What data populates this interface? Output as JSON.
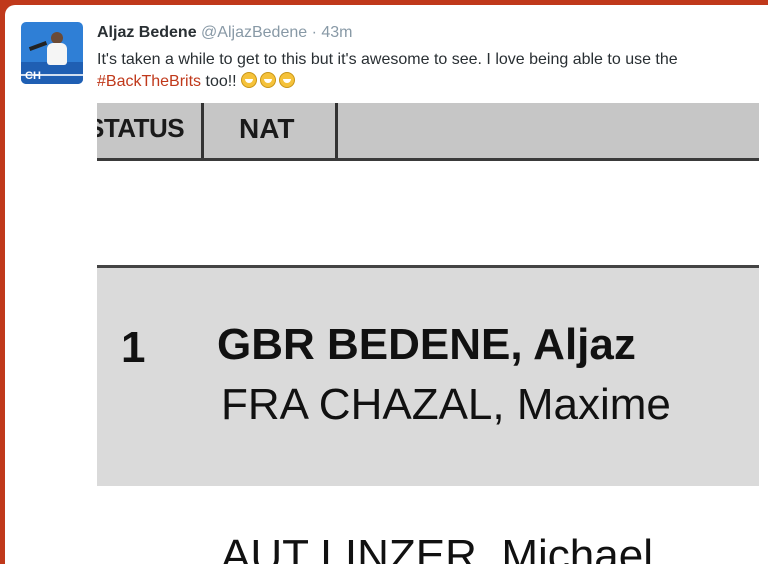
{
  "tweet": {
    "author_name": "Aljaz Bedene",
    "author_handle": "@AljazBedene",
    "separator": "·",
    "time": "43m",
    "text_part1": "It's taken a while to get to this but it's awesome to see. I love being able to use the ",
    "hashtag": "#BackTheBrits",
    "text_part2": " too!! ",
    "emoji_name": "grinning-face-icon",
    "avatar_badge": "CH"
  },
  "photo": {
    "header_status": "STATUS",
    "header_nat": "NAT",
    "seed": "1",
    "player1": "GBR BEDENE, Aljaz",
    "player2": "FRA  CHAZAL, Maxime",
    "player3": "AUT  LINZER, Michael"
  },
  "colors": {
    "frame": "#c0391b",
    "hashtag": "#c0391b",
    "meta_text": "#8899a6"
  }
}
